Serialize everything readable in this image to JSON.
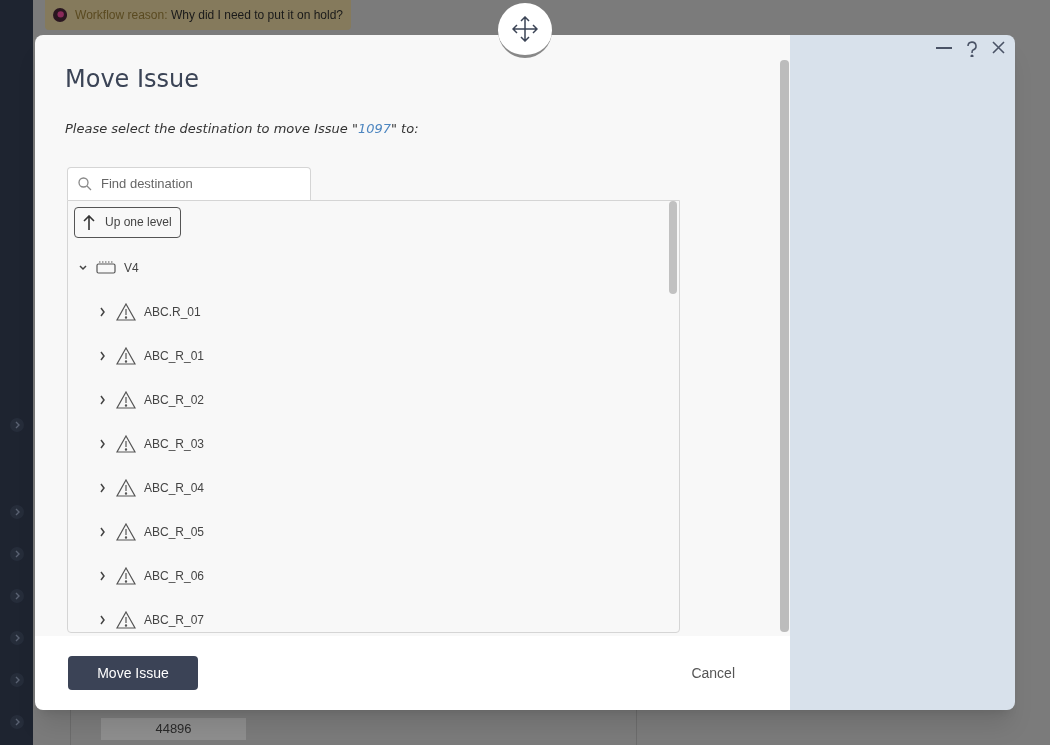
{
  "background": {
    "banner": {
      "label": "Workflow reason:",
      "text": "Why did I need to put it on hold?"
    },
    "field_value": "44896"
  },
  "dialog": {
    "title": "Move Issue",
    "prompt": {
      "before": "Please select the destination to move Issue \"",
      "issue": "1097",
      "after": "\" to:"
    },
    "search": {
      "placeholder": "Find destination"
    },
    "up_button": "Up one level",
    "tree": [
      {
        "label": "V4",
        "kind": "version",
        "expanded": true,
        "children": [
          {
            "label": "ABC.R_01",
            "kind": "warning",
            "expanded": false
          },
          {
            "label": "ABC_R_01",
            "kind": "warning",
            "expanded": false
          },
          {
            "label": "ABC_R_02",
            "kind": "warning",
            "expanded": false
          },
          {
            "label": "ABC_R_03",
            "kind": "warning",
            "expanded": false
          },
          {
            "label": "ABC_R_04",
            "kind": "warning",
            "expanded": false
          },
          {
            "label": "ABC_R_05",
            "kind": "warning",
            "expanded": false
          },
          {
            "label": "ABC_R_06",
            "kind": "warning",
            "expanded": false
          },
          {
            "label": "ABC_R_07",
            "kind": "warning",
            "expanded": false
          }
        ]
      }
    ],
    "buttons": {
      "primary": "Move Issue",
      "cancel": "Cancel"
    }
  }
}
